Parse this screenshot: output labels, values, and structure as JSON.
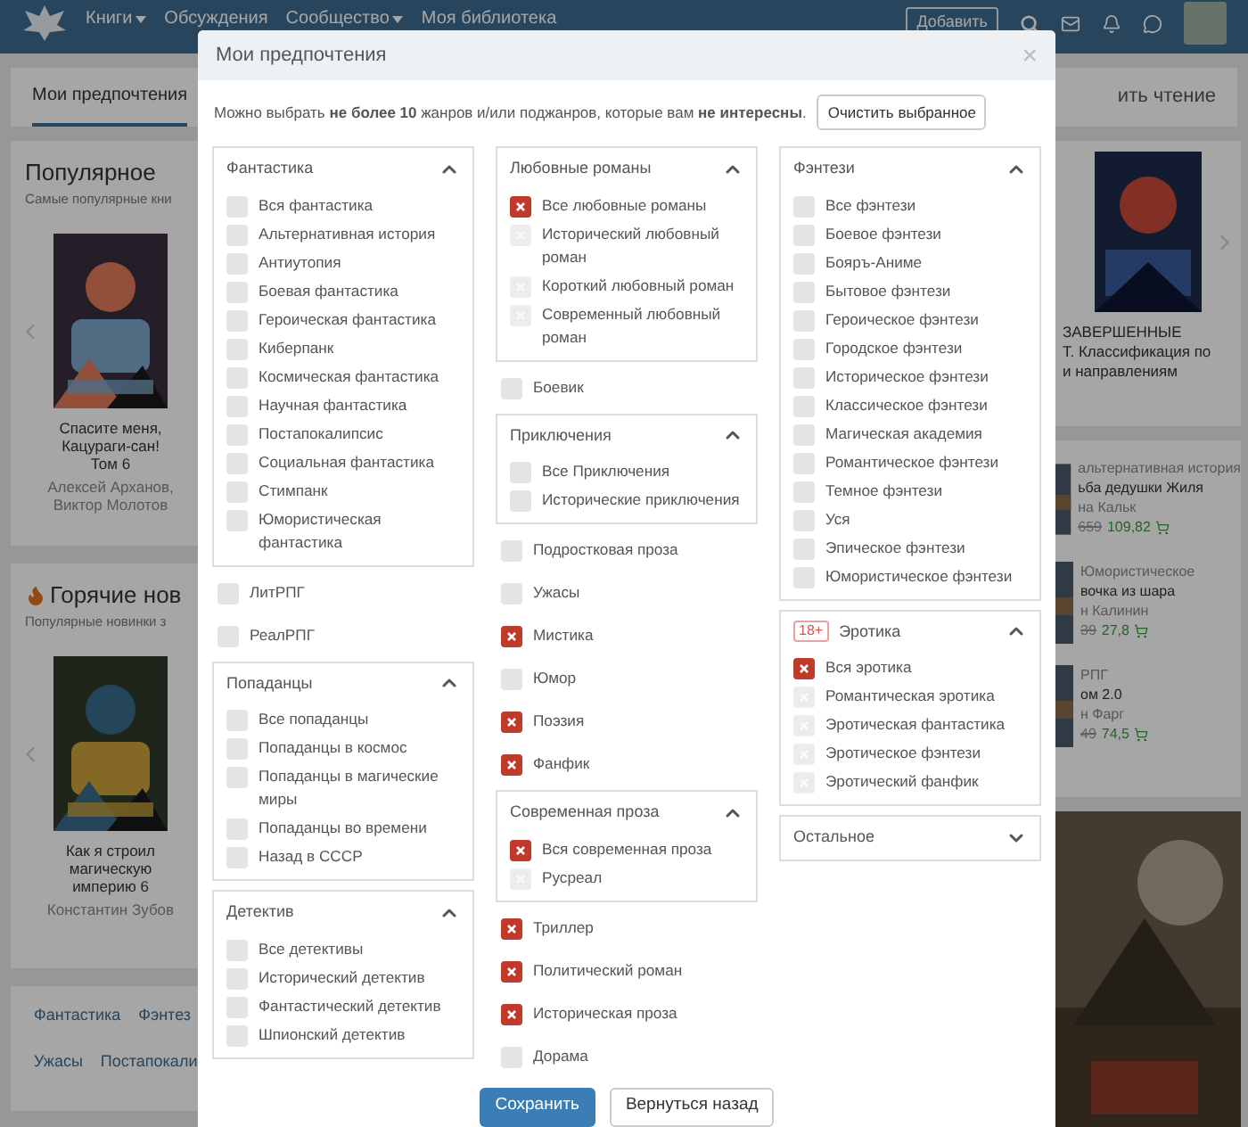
{
  "header": {
    "nav": [
      {
        "label": "Книги",
        "dropdown": true
      },
      {
        "label": "Обсуждения",
        "dropdown": false
      },
      {
        "label": "Сообщество",
        "dropdown": true
      },
      {
        "label": "Моя библиотека",
        "dropdown": false
      }
    ],
    "add_button": "Добавить"
  },
  "tabs": [
    {
      "label": "Мои предпочтения",
      "selected": true
    }
  ],
  "tabs_right": "ить чтение",
  "left_cards": [
    {
      "title": "Популярное",
      "hot": false,
      "subtitle": "Самые популярные кни",
      "book_title": "Спасите меня, Кацураги-сан! Том 6",
      "book_author": "Алексей Арханов, Виктор Молотов"
    },
    {
      "title": "Горячие нов",
      "hot": true,
      "subtitle": "Популярные новинки з",
      "book_title": "Как я строил магическую империю 6",
      "book_author": "Константин Зубов"
    }
  ],
  "genre_links": [
    [
      "Фантастика",
      "Фэнтез"
    ],
    [
      "Ужасы",
      "Постапокали"
    ]
  ],
  "right_feature": [
    "ЗАВЕРШЕННЫЕ",
    "Т. Классификация по",
    "и направлениям"
  ],
  "right_books": [
    {
      "genre": "альтернативная история",
      "title": "ьба дедушки Жиля",
      "author": "на Кальк",
      "old_price": "659",
      "price": "109,82"
    },
    {
      "genre": "Юмористическое",
      "title": "вочка из шара",
      "author": "н Калинин",
      "old_price": "39",
      "price": "27,8"
    },
    {
      "genre": "РПГ",
      "title": "ом 2.0",
      "author": "н Фарг",
      "old_price": "49",
      "price": "74,5"
    }
  ],
  "modal": {
    "title": "Мои предпочтения",
    "close": "×",
    "intro": "Можно выбрать **не более 10** жанров и/или поджанров, которые вам **не интересны**.",
    "clear_button": "Очистить выбранное",
    "columns": [
      {
        "blocks": [
          {
            "kind": "group",
            "title": "Фантастика",
            "expanded": true,
            "items": [
              {
                "label": "Вся фантастика",
                "checked": false,
                "inherited": false
              },
              {
                "label": "Альтернативная история",
                "checked": false,
                "inherited": false
              },
              {
                "label": "Антиутопия",
                "checked": false,
                "inherited": false
              },
              {
                "label": "Боевая фантастика",
                "checked": false,
                "inherited": false
              },
              {
                "label": "Героическая фантастика",
                "checked": false,
                "inherited": false
              },
              {
                "label": "Киберпанк",
                "checked": false,
                "inherited": false
              },
              {
                "label": "Космическая фантастика",
                "checked": false,
                "inherited": false
              },
              {
                "label": "Научная фантастика",
                "checked": false,
                "inherited": false
              },
              {
                "label": "Постапокалипсис",
                "checked": false,
                "inherited": false
              },
              {
                "label": "Социальная фантастика",
                "checked": false,
                "inherited": false
              },
              {
                "label": "Стимпанк",
                "checked": false,
                "inherited": false
              },
              {
                "label": "Юмористическая фантастика",
                "checked": false,
                "inherited": false
              }
            ]
          },
          {
            "kind": "check",
            "label": "ЛитРПГ",
            "checked": false
          },
          {
            "kind": "check",
            "label": "РеалРПГ",
            "checked": false
          },
          {
            "kind": "group",
            "title": "Попаданцы",
            "expanded": true,
            "items": [
              {
                "label": "Все попаданцы",
                "checked": false,
                "inherited": false
              },
              {
                "label": "Попаданцы в космос",
                "checked": false,
                "inherited": false
              },
              {
                "label": "Попаданцы в магические миры",
                "checked": false,
                "inherited": false
              },
              {
                "label": "Попаданцы во времени",
                "checked": false,
                "inherited": false
              },
              {
                "label": "Назад в СССР",
                "checked": false,
                "inherited": false
              }
            ]
          },
          {
            "kind": "group",
            "title": "Детектив",
            "expanded": true,
            "items": [
              {
                "label": "Все детективы",
                "checked": false,
                "inherited": false
              },
              {
                "label": "Исторический детектив",
                "checked": false,
                "inherited": false
              },
              {
                "label": "Фантастический детектив",
                "checked": false,
                "inherited": false
              },
              {
                "label": "Шпионский детектив",
                "checked": false,
                "inherited": false
              }
            ]
          }
        ]
      },
      {
        "blocks": [
          {
            "kind": "group",
            "title": "Любовные романы",
            "expanded": true,
            "items": [
              {
                "label": "Все любовные романы",
                "checked": true,
                "inherited": false
              },
              {
                "label": "Исторический любовный роман",
                "checked": false,
                "inherited": true
              },
              {
                "label": "Короткий любовный роман",
                "checked": false,
                "inherited": true
              },
              {
                "label": "Современный любовный роман",
                "checked": false,
                "inherited": true
              }
            ]
          },
          {
            "kind": "check",
            "label": "Боевик",
            "checked": false
          },
          {
            "kind": "group",
            "title": "Приключения",
            "expanded": true,
            "items": [
              {
                "label": "Все Приключения",
                "checked": false,
                "inherited": false
              },
              {
                "label": "Исторические приключения",
                "checked": false,
                "inherited": false
              }
            ]
          },
          {
            "kind": "check",
            "label": "Подростковая проза",
            "checked": false
          },
          {
            "kind": "check",
            "label": "Ужасы",
            "checked": false
          },
          {
            "kind": "check",
            "label": "Мистика",
            "checked": true
          },
          {
            "kind": "check",
            "label": "Юмор",
            "checked": false
          },
          {
            "kind": "check",
            "label": "Поэзия",
            "checked": true
          },
          {
            "kind": "check",
            "label": "Фанфик",
            "checked": true
          },
          {
            "kind": "group",
            "title": "Современная проза",
            "expanded": true,
            "items": [
              {
                "label": "Вся современная проза",
                "checked": true,
                "inherited": false
              },
              {
                "label": "Русреал",
                "checked": false,
                "inherited": true
              }
            ]
          },
          {
            "kind": "check",
            "label": "Триллер",
            "checked": true
          },
          {
            "kind": "check",
            "label": "Политический роман",
            "checked": true
          },
          {
            "kind": "check",
            "label": "Историческая проза",
            "checked": true
          },
          {
            "kind": "check",
            "label": "Дорама",
            "checked": false
          }
        ]
      },
      {
        "blocks": [
          {
            "kind": "group",
            "title": "Фэнтези",
            "expanded": true,
            "items": [
              {
                "label": "Все фэнтези",
                "checked": false,
                "inherited": false
              },
              {
                "label": "Боевое фэнтези",
                "checked": false,
                "inherited": false
              },
              {
                "label": "Бояръ-Аниме",
                "checked": false,
                "inherited": false
              },
              {
                "label": "Бытовое фэнтези",
                "checked": false,
                "inherited": false
              },
              {
                "label": "Героическое фэнтези",
                "checked": false,
                "inherited": false
              },
              {
                "label": "Городское фэнтези",
                "checked": false,
                "inherited": false
              },
              {
                "label": "Историческое фэнтези",
                "checked": false,
                "inherited": false
              },
              {
                "label": "Классическое фэнтези",
                "checked": false,
                "inherited": false
              },
              {
                "label": "Магическая академия",
                "checked": false,
                "inherited": false
              },
              {
                "label": "Романтическое фэнтези",
                "checked": false,
                "inherited": false
              },
              {
                "label": "Темное фэнтези",
                "checked": false,
                "inherited": false
              },
              {
                "label": "Уся",
                "checked": false,
                "inherited": false
              },
              {
                "label": "Эпическое фэнтези",
                "checked": false,
                "inherited": false
              },
              {
                "label": "Юмористическое фэнтези",
                "checked": false,
                "inherited": false
              }
            ]
          },
          {
            "kind": "group",
            "title": "Эротика",
            "badge": "18+",
            "expanded": true,
            "items": [
              {
                "label": "Вся эротика",
                "checked": true,
                "inherited": false
              },
              {
                "label": "Романтическая эротика",
                "checked": false,
                "inherited": true
              },
              {
                "label": "Эротическая фантастика",
                "checked": false,
                "inherited": true
              },
              {
                "label": "Эротическое фэнтези",
                "checked": false,
                "inherited": true
              },
              {
                "label": "Эротический фанфик",
                "checked": false,
                "inherited": true
              }
            ]
          },
          {
            "kind": "group",
            "title": "Остальное",
            "expanded": false
          }
        ]
      }
    ],
    "save_button": "Сохранить",
    "back_button": "Вернуться назад"
  }
}
